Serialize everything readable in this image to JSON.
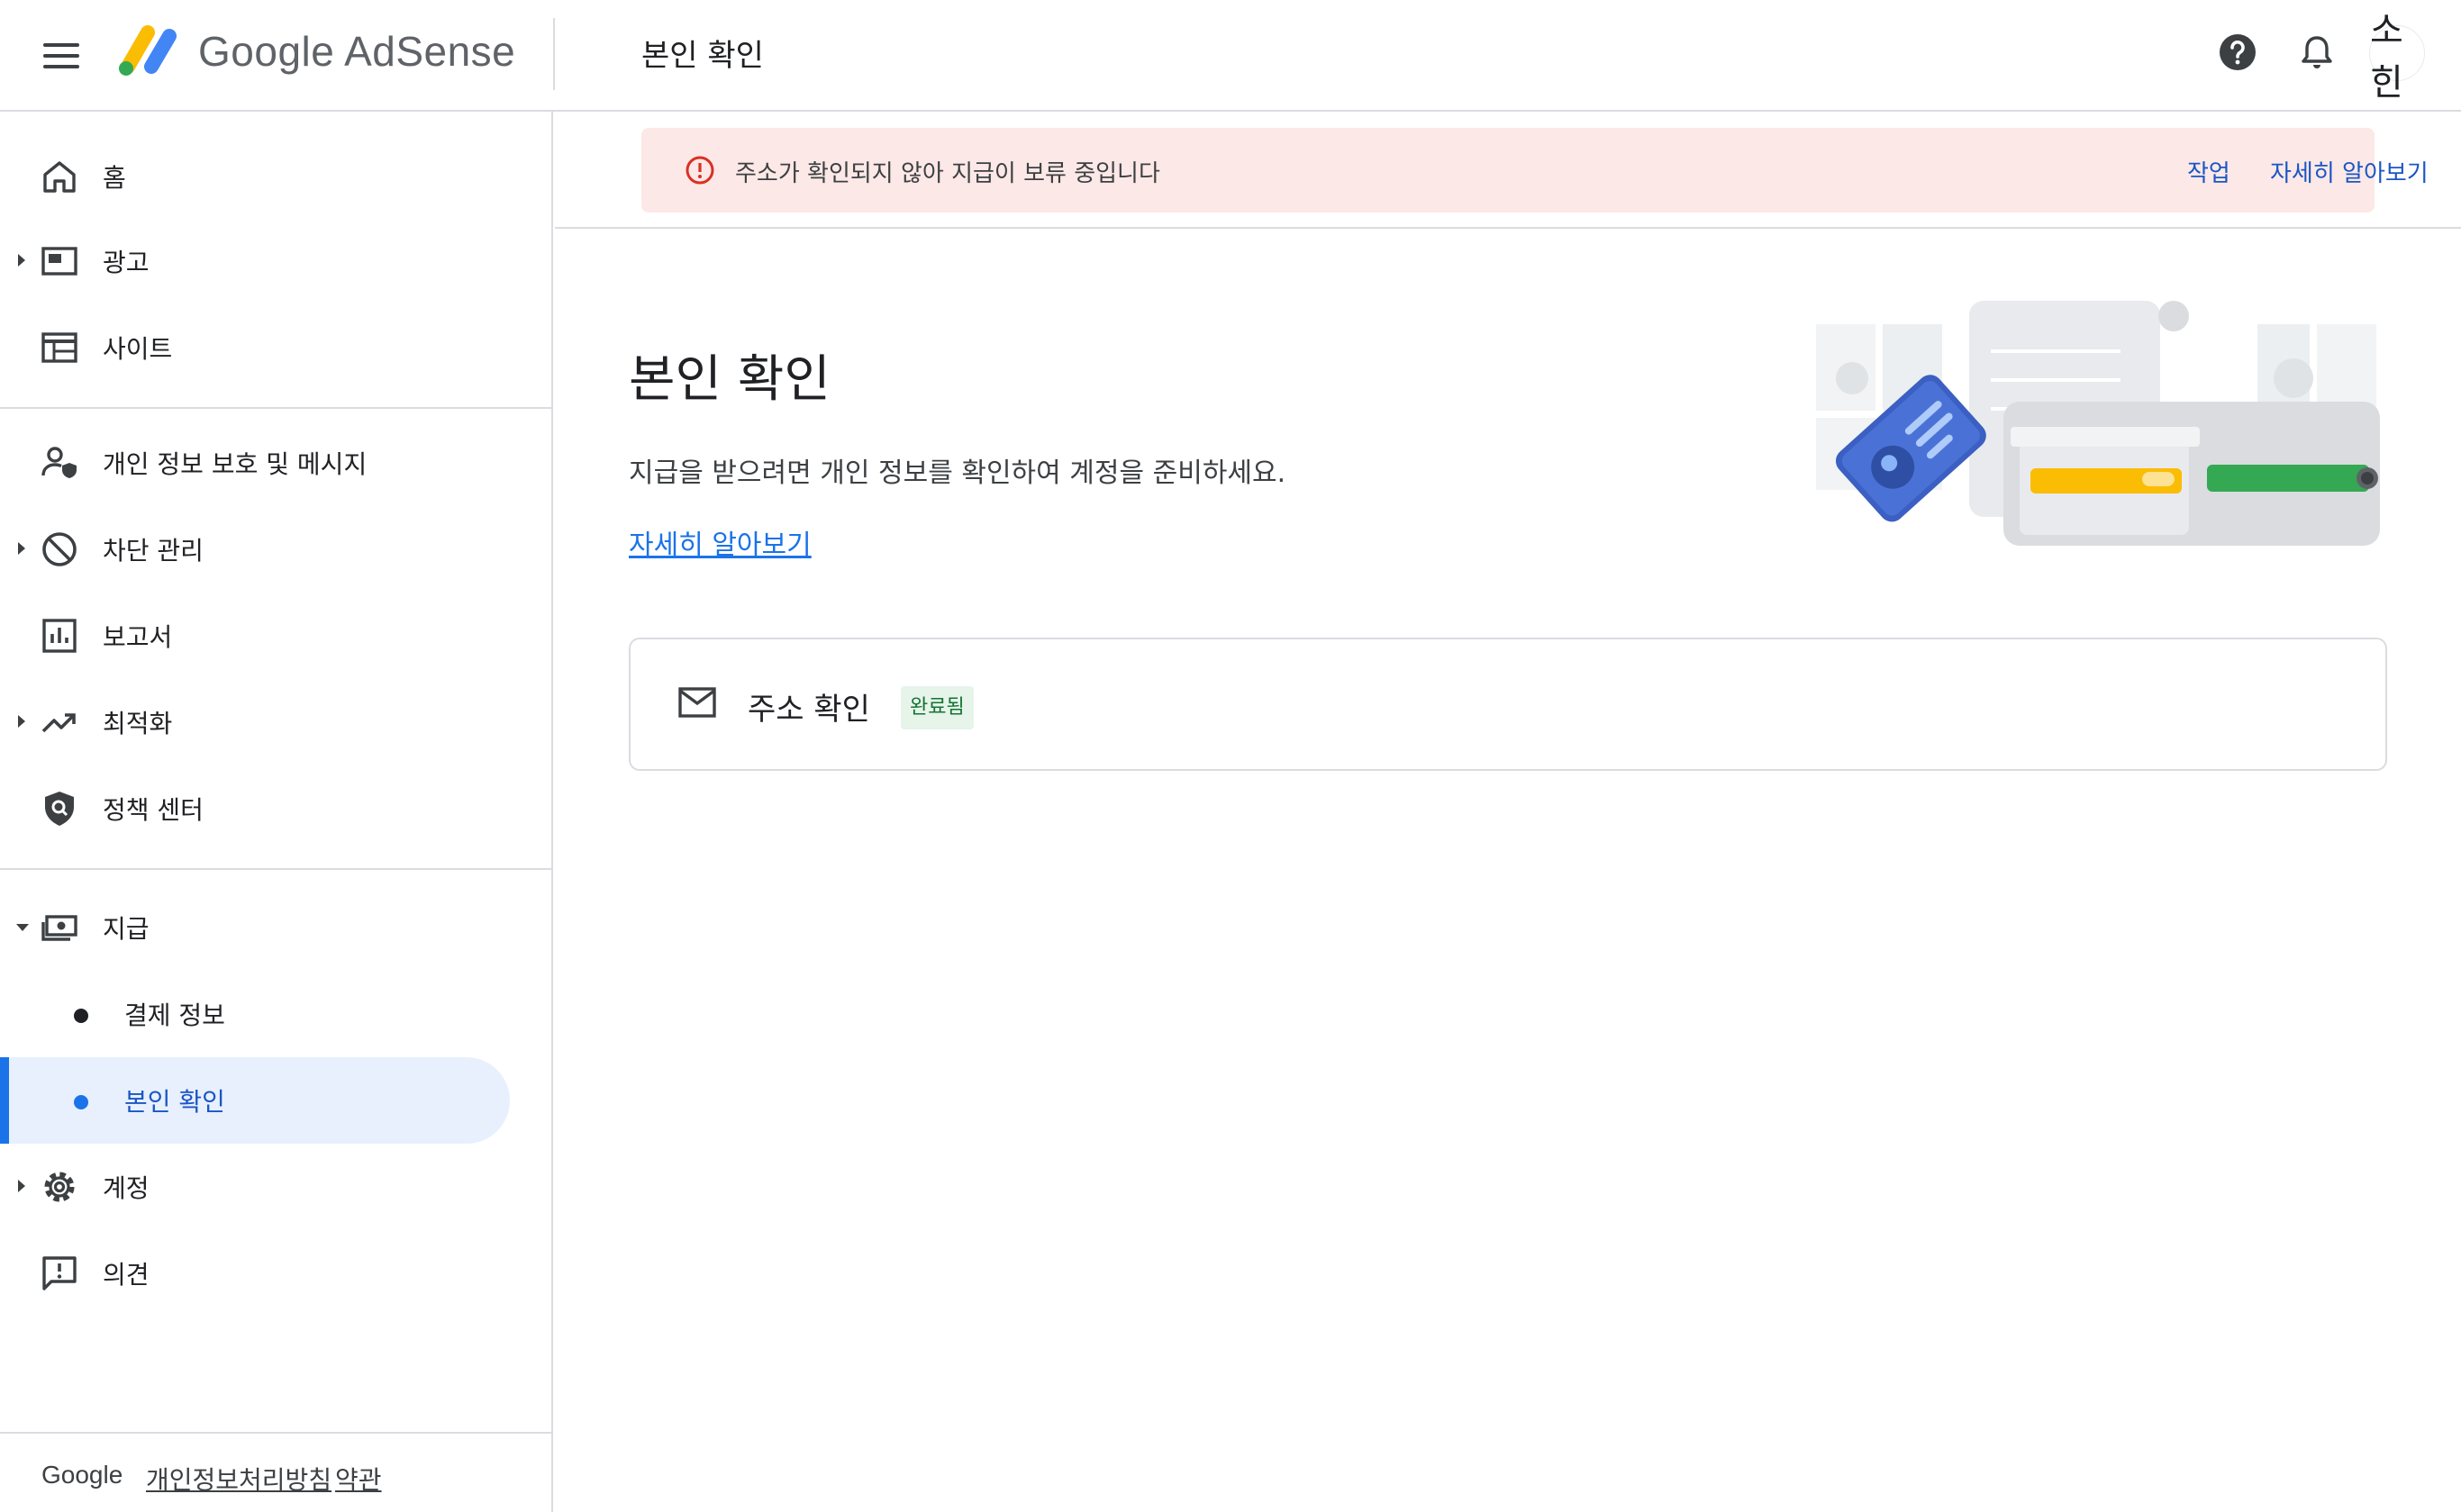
{
  "header": {
    "app_name": "Google AdSense",
    "page_title": "본인 확인",
    "avatar_text": "소힌"
  },
  "sidebar": {
    "items": [
      {
        "label": "홈"
      },
      {
        "label": "광고"
      },
      {
        "label": "사이트"
      },
      {
        "label": "개인 정보 보호 및 메시지"
      },
      {
        "label": "차단 관리"
      },
      {
        "label": "보고서"
      },
      {
        "label": "최적화"
      },
      {
        "label": "정책 센터"
      },
      {
        "label": "지급"
      },
      {
        "label": "결제 정보"
      },
      {
        "label": "본인 확인"
      },
      {
        "label": "계정"
      },
      {
        "label": "의견"
      }
    ],
    "footer": {
      "google": "Google",
      "privacy": "개인정보처리방침",
      "terms": "약관"
    }
  },
  "banner": {
    "message": "주소가 확인되지 않아 지급이 보류 중입니다",
    "action": "작업",
    "learn_more": "자세히 알아보기"
  },
  "main": {
    "heading": "본인 확인",
    "description": "지급을 받으려면 개인 정보를 확인하여 계정을 준비하세요.",
    "link": "자세히 알아보기",
    "card": {
      "title": "주소 확인",
      "status": "완료됨"
    }
  },
  "colors": {
    "accent": "#1a73e8",
    "banner_bg": "#fce8e6",
    "error": "#d93025",
    "success_bg": "#e6f4ea",
    "success_text": "#137333"
  }
}
